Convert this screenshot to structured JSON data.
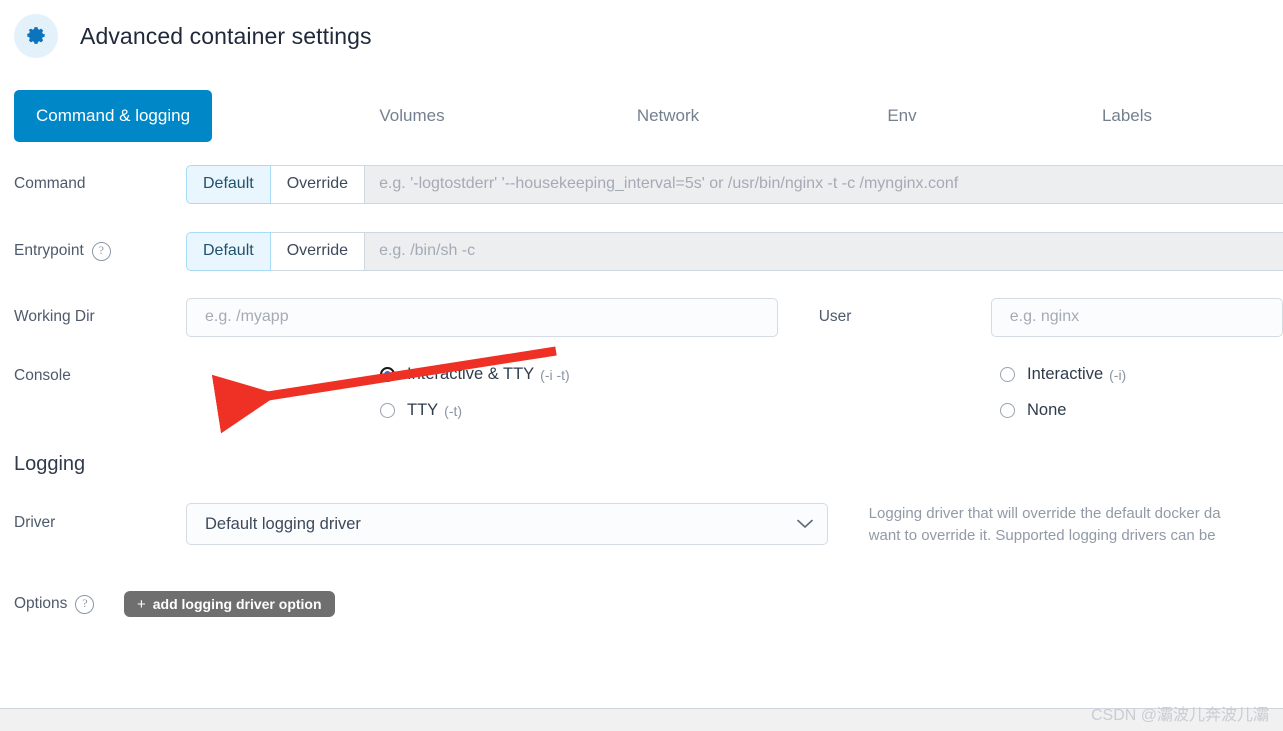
{
  "header": {
    "title": "Advanced container settings",
    "icon": "gear-icon"
  },
  "tabs": [
    {
      "label": "Command & logging",
      "active": true
    },
    {
      "label": "Volumes",
      "active": false
    },
    {
      "label": "Network",
      "active": false
    },
    {
      "label": "Env",
      "active": false
    },
    {
      "label": "Labels",
      "active": false
    }
  ],
  "form": {
    "command": {
      "label": "Command",
      "toggle": {
        "default_label": "Default",
        "override_label": "Override",
        "selected": "Default"
      },
      "placeholder": "e.g. '-logtostderr' '--housekeeping_interval=5s' or /usr/bin/nginx -t -c /mynginx.conf",
      "value": ""
    },
    "entrypoint": {
      "label": "Entrypoint",
      "help_icon": "question-mark-icon",
      "toggle": {
        "default_label": "Default",
        "override_label": "Override",
        "selected": "Default"
      },
      "placeholder": "e.g. /bin/sh -c",
      "value": ""
    },
    "working_dir": {
      "label": "Working Dir",
      "placeholder": "e.g. /myapp",
      "value": ""
    },
    "user": {
      "label": "User",
      "placeholder": "e.g. nginx",
      "value": ""
    },
    "console": {
      "label": "Console",
      "selected": "Interactive & TTY",
      "options": [
        {
          "label": "Interactive & TTY",
          "hint": "(-i -t)",
          "selected": true
        },
        {
          "label": "TTY",
          "hint": "(-t)",
          "selected": false
        },
        {
          "label": "Interactive",
          "hint": "(-i)",
          "selected": false
        },
        {
          "label": "None",
          "hint": "",
          "selected": false
        }
      ]
    }
  },
  "logging": {
    "section_title": "Logging",
    "driver": {
      "label": "Driver",
      "value": "Default logging driver",
      "chevron_icon": "chevron-down-icon",
      "help_line1": "Logging driver that will override the default docker da",
      "help_line2": "want to override it. Supported logging drivers can be"
    },
    "options": {
      "label": "Options",
      "help_icon": "question-mark-icon",
      "add_button": "add logging driver option",
      "add_button_plus": "+"
    }
  },
  "annotation": {
    "arrow": "red-arrow",
    "color": "#ee3124"
  },
  "watermark": {
    "text": "CSDN @灞波儿奔波儿灞"
  },
  "colors": {
    "accent": "#0087c7",
    "radio_selected": "#1176f0",
    "toggle_active_bg": "#eaf6fd",
    "pill_bg": "#6f6f6f"
  }
}
